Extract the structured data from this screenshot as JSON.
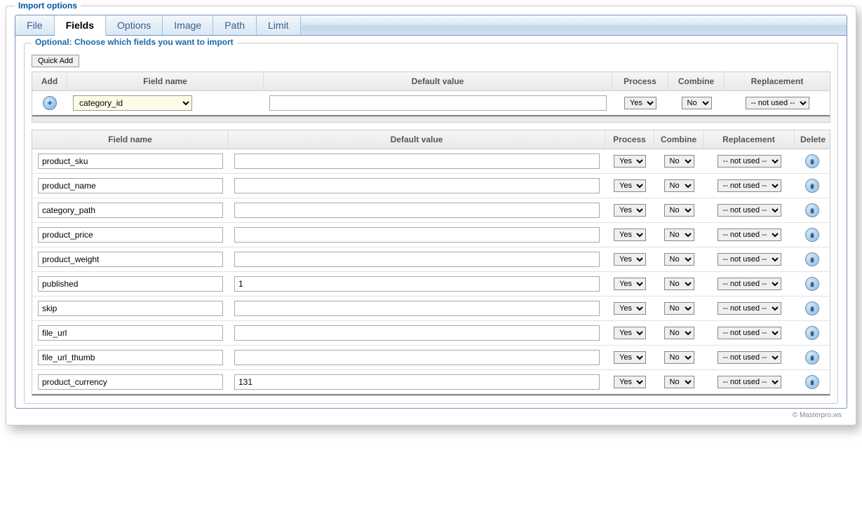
{
  "panel_title": "Import options",
  "tabs": [
    "File",
    "Fields",
    "Options",
    "Image",
    "Path",
    "Limit"
  ],
  "active_tab": 1,
  "section_title": "Optional: Choose which fields you want to import",
  "quick_add_label": "Quick Add",
  "top_headers": {
    "add": "Add",
    "field": "Field name",
    "default": "Default value",
    "process": "Process",
    "combine": "Combine",
    "replacement": "Replacement"
  },
  "bottom_headers": {
    "field": "Field name",
    "default": "Default value",
    "process": "Process",
    "combine": "Combine",
    "replacement": "Replacement",
    "delete": "Delete"
  },
  "add_row": {
    "field": "category_id",
    "default": "",
    "process": "Yes",
    "combine": "No",
    "replacement": "-- not used --"
  },
  "rows": [
    {
      "field": "product_sku",
      "default": "",
      "process": "Yes",
      "combine": "No",
      "replacement": "-- not used --"
    },
    {
      "field": "product_name",
      "default": "",
      "process": "Yes",
      "combine": "No",
      "replacement": "-- not used --"
    },
    {
      "field": "category_path",
      "default": "",
      "process": "Yes",
      "combine": "No",
      "replacement": "-- not used --"
    },
    {
      "field": "product_price",
      "default": "",
      "process": "Yes",
      "combine": "No",
      "replacement": "-- not used --"
    },
    {
      "field": "product_weight",
      "default": "",
      "process": "Yes",
      "combine": "No",
      "replacement": "-- not used --"
    },
    {
      "field": "published",
      "default": "1",
      "process": "Yes",
      "combine": "No",
      "replacement": "-- not used --"
    },
    {
      "field": "skip",
      "default": "",
      "process": "Yes",
      "combine": "No",
      "replacement": "-- not used --"
    },
    {
      "field": "file_url",
      "default": "",
      "process": "Yes",
      "combine": "No",
      "replacement": "-- not used --"
    },
    {
      "field": "file_url_thumb",
      "default": "",
      "process": "Yes",
      "combine": "No",
      "replacement": "-- not used --"
    },
    {
      "field": "product_currency",
      "default": "131",
      "process": "Yes",
      "combine": "No",
      "replacement": "-- not used --"
    }
  ],
  "footer": "© Masterpro.ws"
}
